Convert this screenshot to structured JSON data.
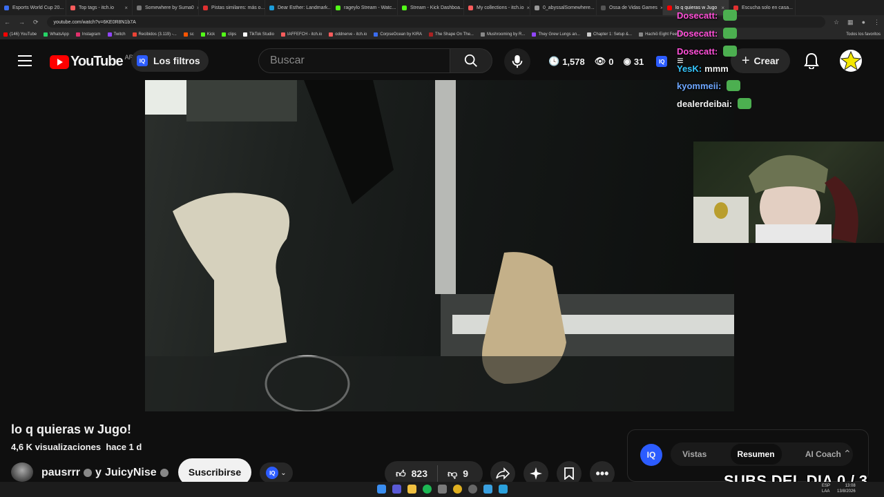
{
  "browser": {
    "tabs": [
      {
        "label": "Esports World Cup 20...",
        "color": "#3a6df0"
      },
      {
        "label": "Top tags - itch.io",
        "color": "#fa5c5c"
      },
      {
        "label": "Somewhere by Suma0",
        "color": "#777777"
      },
      {
        "label": "Pistas similares: más o...",
        "color": "#e03030"
      },
      {
        "label": "Dear Esther: Landmark...",
        "color": "#1b9bd8"
      },
      {
        "label": "rageylo Stream - Watc...",
        "color": "#53fc18"
      },
      {
        "label": "Stream - Kick Dashboa...",
        "color": "#53fc18"
      },
      {
        "label": "My collections - itch.io",
        "color": "#fa5c5c"
      },
      {
        "label": "0_abyssalSomewhere...",
        "color": "#999999"
      },
      {
        "label": "Ossa de Vidas Games",
        "color": "#555555"
      },
      {
        "label": "lo q quieras w Jugo",
        "color": "#ff0000",
        "active": true
      },
      {
        "label": "Escucha solo en casa...",
        "color": "#e03030"
      }
    ],
    "url": "youtube.com/watch?v=6KE0R8N1b7A",
    "bookmarks": [
      {
        "label": "(146) YouTube",
        "color": "#ff0000"
      },
      {
        "label": "WhatsApp",
        "color": "#25d366"
      },
      {
        "label": "Instagram",
        "color": "#e1306c"
      },
      {
        "label": "Twitch",
        "color": "#9146ff"
      },
      {
        "label": "Recibidos (3.119) -...",
        "color": "#ea4335"
      },
      {
        "label": "sc",
        "color": "#ff5500"
      },
      {
        "label": "Kick",
        "color": "#53fc18"
      },
      {
        "label": "clips",
        "color": "#53fc18"
      },
      {
        "label": "TikTok Studio",
        "color": "#ffffff"
      },
      {
        "label": "IAFFEFCH - itch.io",
        "color": "#fa5c5c"
      },
      {
        "label": "oddnerve - itch.io",
        "color": "#fa5c5c"
      },
      {
        "label": "CorpseOcean by KIRA",
        "color": "#3a6df0"
      },
      {
        "label": "The Shape On The...",
        "color": "#aa2222"
      },
      {
        "label": "Mushrooming by R...",
        "color": "#888888"
      },
      {
        "label": "They Grew Lungs an...",
        "color": "#9146ff"
      },
      {
        "label": "Chapter 1: Setup &...",
        "color": "#cccccc"
      },
      {
        "label": "Hachiō Eight Feet Tal...",
        "color": "#888888"
      }
    ],
    "all_bookmarks": "Todos los favoritos"
  },
  "header": {
    "logo_text": "YouTube",
    "country": "AR",
    "filters_label": "Los filtros",
    "iq_label": "IQ",
    "search_placeholder": "Buscar",
    "stats": {
      "time": "1,578",
      "views": "0",
      "watching": "31"
    },
    "create_label": "Crear"
  },
  "overlay_chat": [
    {
      "user": "Dosecatt:",
      "color": "#ff4fd8",
      "text": ""
    },
    {
      "user": "Dosecatt:",
      "color": "#ff4fd8",
      "text": ""
    },
    {
      "user": "Dosecatt:",
      "color": "#ff4fd8",
      "text": ""
    },
    {
      "user": "YesK:",
      "color": "#35c7ff",
      "text": "mmm"
    },
    {
      "user": "kyommeii:",
      "color": "#6da7ff",
      "text": ""
    },
    {
      "user": "dealerdeibai:",
      "color": "#f1f1f1",
      "text": ""
    }
  ],
  "video": {
    "title": "lo q quieras w Jugo!",
    "views": "4,6 K visualizaciones",
    "age": "hace 1 d",
    "channel": "pausrrr",
    "collab_connector": "y",
    "collab_channel": "JuicyNise",
    "subscribe_label": "Suscribirse",
    "likes": "823",
    "dislikes": "9"
  },
  "side_panel": {
    "tabs": [
      "Vistas",
      "Resumen",
      "AI Coach"
    ],
    "selected": "Resumen"
  },
  "stream_overlay": {
    "subs_text": "SUBS DEL DIA 0 / 3"
  },
  "tray": {
    "lang": "ESP\nLAA",
    "time": "13:08",
    "date": "13/8/2026"
  }
}
